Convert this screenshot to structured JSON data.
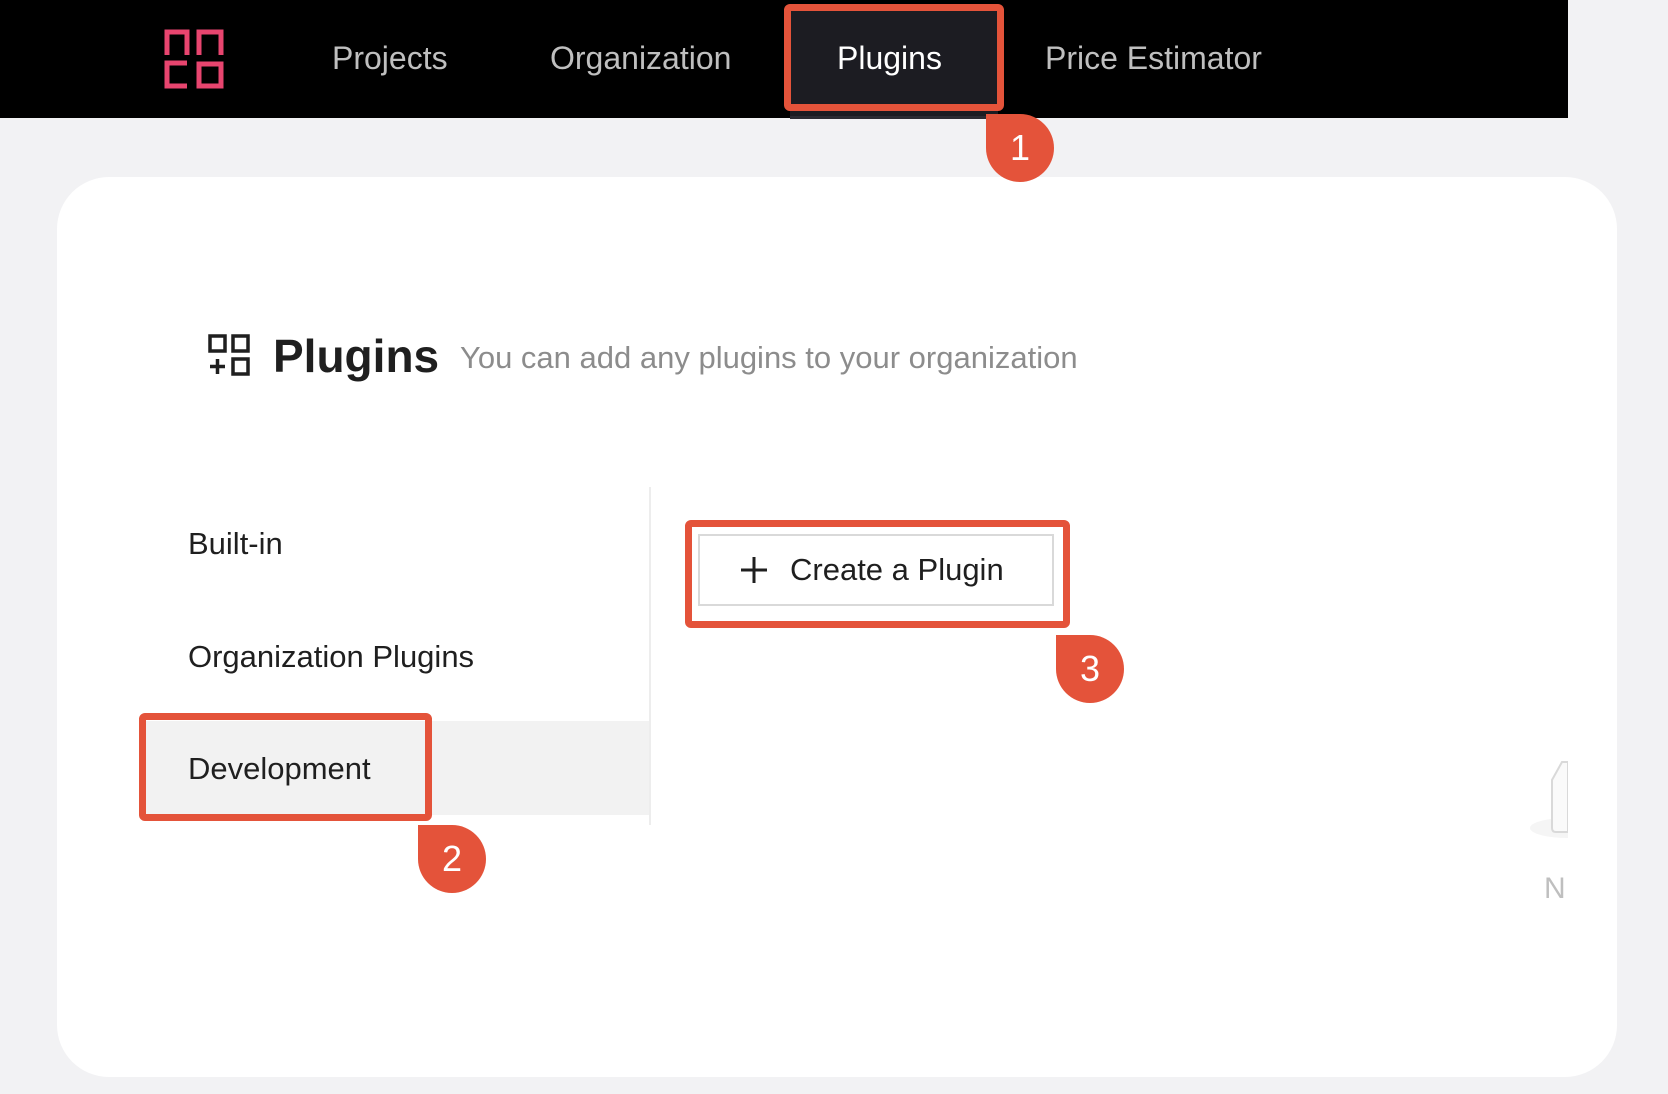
{
  "nav": {
    "items": [
      {
        "label": "Projects"
      },
      {
        "label": "Organization"
      },
      {
        "label": "Plugins"
      },
      {
        "label": "Price Estimator"
      }
    ],
    "active": "Plugins"
  },
  "page": {
    "title": "Plugins",
    "subtitle": "You can add any plugins to your organization"
  },
  "sidebar": {
    "items": [
      {
        "label": "Built-in"
      },
      {
        "label": "Organization Plugins"
      },
      {
        "label": "Development"
      }
    ],
    "selected": "Development"
  },
  "main": {
    "create_button_label": "Create a Plugin"
  },
  "annotations": [
    {
      "number": "1",
      "target": "Plugins tab"
    },
    {
      "number": "2",
      "target": "Development"
    },
    {
      "number": "3",
      "target": "Create a Plugin"
    }
  ],
  "edge_text": "N",
  "colors": {
    "accent": "#e4533a",
    "logo": "#e8456f",
    "topbar": "#000000"
  }
}
